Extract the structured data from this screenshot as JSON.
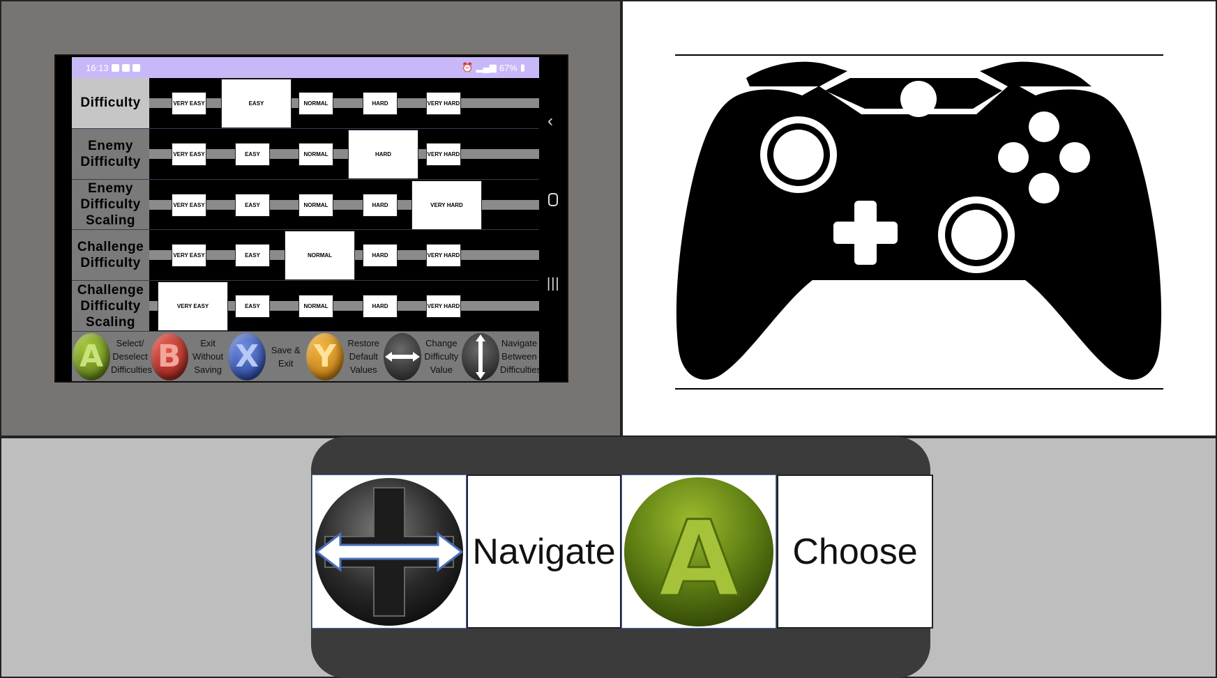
{
  "phone": {
    "status": {
      "time": "16:13",
      "battery": "67%"
    },
    "rows": [
      {
        "label": "Difficulty",
        "selected": 1,
        "options": [
          "VERY EASY",
          "EASY",
          "NORMAL",
          "HARD",
          "VERY HARD"
        ]
      },
      {
        "label": "Enemy Difficulty",
        "selected": 3,
        "options": [
          "VERY EASY",
          "EASY",
          "NORMAL",
          "HARD",
          "VERY HARD"
        ]
      },
      {
        "label": "Enemy Difficulty Scaling",
        "selected": 4,
        "options": [
          "VERY EASY",
          "EASY",
          "NORMAL",
          "HARD",
          "VERY HARD"
        ]
      },
      {
        "label": "Challenge Difficulty",
        "selected": 2,
        "options": [
          "VERY EASY",
          "EASY",
          "NORMAL",
          "HARD",
          "VERY HARD"
        ]
      },
      {
        "label": "Challenge Difficulty Scaling",
        "selected": 0,
        "options": [
          "VERY EASY",
          "EASY",
          "NORMAL",
          "HARD",
          "VERY HARD"
        ]
      }
    ],
    "legend": [
      {
        "button": "A",
        "text": "Select/ Deselect Difficulties"
      },
      {
        "button": "B",
        "text": "Exit Without Saving"
      },
      {
        "button": "X",
        "text": "Save & Exit"
      },
      {
        "button": "Y",
        "text": "Restore Default Values"
      },
      {
        "button": "dpad-horizontal-icon",
        "text": "Change Difficulty Value"
      },
      {
        "button": "dpad-vertical-icon",
        "text": "Navigate Between Difficulties"
      }
    ],
    "nav_icons": [
      "back-icon",
      "home-icon",
      "recents-icon"
    ]
  },
  "controller": {
    "icon": "gamepad-icon"
  },
  "bottom_legend": {
    "navigate_label": "Navigate",
    "choose_label": "Choose",
    "a_letter": "A"
  },
  "colors": {
    "status_bar": "#c8b8f8",
    "label_bg": "#7a7a7a",
    "label_active": "#c6c6c6",
    "a_button": "#6b8c1e"
  }
}
